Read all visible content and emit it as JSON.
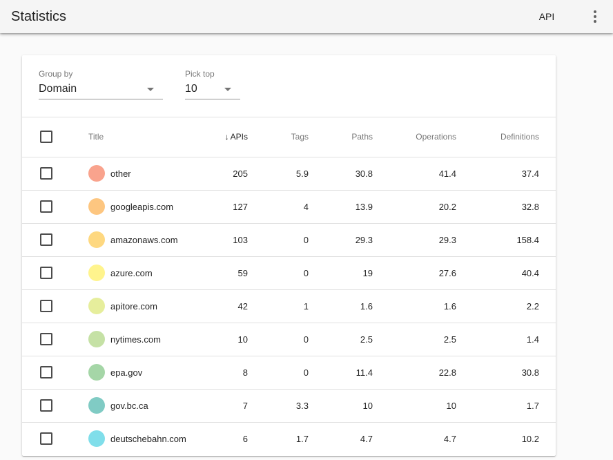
{
  "appbar": {
    "title": "Statistics",
    "api_label": "API",
    "more_icon": "more-vert-icon"
  },
  "filters": {
    "group_by": {
      "label": "Group by",
      "value": "Domain"
    },
    "pick_top": {
      "label": "Pick top",
      "value": "10"
    }
  },
  "table": {
    "columns": {
      "title": "Title",
      "apis": "APIs",
      "tags": "Tags",
      "paths": "Paths",
      "operations": "Operations",
      "definitions": "Definitions"
    },
    "sort_indicator": "↓",
    "rows": [
      {
        "title": "other",
        "color": "#f9a38d",
        "apis": "205",
        "tags": "5.9",
        "paths": "30.8",
        "operations": "41.4",
        "definitions": "37.4"
      },
      {
        "title": "googleapis.com",
        "color": "#fdc680",
        "apis": "127",
        "tags": "4",
        "paths": "13.9",
        "operations": "20.2",
        "definitions": "32.8"
      },
      {
        "title": "amazonaws.com",
        "color": "#fed880",
        "apis": "103",
        "tags": "0",
        "paths": "29.3",
        "operations": "29.3",
        "definitions": "158.4"
      },
      {
        "title": "azure.com",
        "color": "#fff48d",
        "apis": "59",
        "tags": "0",
        "paths": "19",
        "operations": "27.6",
        "definitions": "40.4"
      },
      {
        "title": "apitore.com",
        "color": "#e6ee9c",
        "apis": "42",
        "tags": "1",
        "paths": "1.6",
        "operations": "1.6",
        "definitions": "2.2"
      },
      {
        "title": "nytimes.com",
        "color": "#c5e1a5",
        "apis": "10",
        "tags": "0",
        "paths": "2.5",
        "operations": "2.5",
        "definitions": "1.4"
      },
      {
        "title": "epa.gov",
        "color": "#a5d6a7",
        "apis": "8",
        "tags": "0",
        "paths": "11.4",
        "operations": "22.8",
        "definitions": "30.8"
      },
      {
        "title": "gov.bc.ca",
        "color": "#80cbc4",
        "apis": "7",
        "tags": "3.3",
        "paths": "10",
        "operations": "10",
        "definitions": "1.7"
      },
      {
        "title": "deutschebahn.com",
        "color": "#80deea",
        "apis": "6",
        "tags": "1.7",
        "paths": "4.7",
        "operations": "4.7",
        "definitions": "10.2"
      }
    ]
  }
}
